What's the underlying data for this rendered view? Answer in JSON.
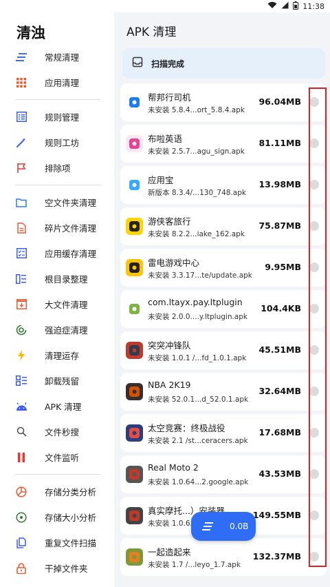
{
  "status_bar": {
    "time": "11:38"
  },
  "sidebar": {
    "title": "清浊",
    "groups": [
      [
        {
          "label": "常规清理",
          "icon": "sweep-icon"
        },
        {
          "label": "应用清理",
          "icon": "grid-icon"
        }
      ],
      [
        {
          "label": "规则管理",
          "icon": "list-icon"
        },
        {
          "label": "规则工坊",
          "icon": "magic-wand-icon"
        },
        {
          "label": "排除项",
          "icon": "flag-icon"
        }
      ],
      [
        {
          "label": "空文件夹清理",
          "icon": "folder-icon"
        },
        {
          "label": "碎片文件清理",
          "icon": "document-icon"
        },
        {
          "label": "应用缓存清理",
          "icon": "checklist-icon"
        },
        {
          "label": "根目录整理",
          "icon": "columns-icon"
        },
        {
          "label": "大文件清理",
          "icon": "archive-icon"
        },
        {
          "label": "强迫症清理",
          "icon": "target-icon"
        },
        {
          "label": "清理运存",
          "icon": "lightning-icon"
        },
        {
          "label": "卸载残留",
          "icon": "apps-list-icon"
        },
        {
          "label": "APK 清理",
          "icon": "android-icon"
        },
        {
          "label": "文件秒搜",
          "icon": "search-icon"
        },
        {
          "label": "文件监听",
          "icon": "pause-icon"
        }
      ],
      [
        {
          "label": "存储分类分析",
          "icon": "pie-chart-icon"
        },
        {
          "label": "存储大小分析",
          "icon": "disk-icon"
        },
        {
          "label": "重复文件扫描",
          "icon": "copy-icon"
        },
        {
          "label": "干掉文件夹",
          "icon": "lock-icon"
        }
      ]
    ]
  },
  "main": {
    "title": "APK 清理",
    "scan_status": "扫描完成",
    "items": [
      {
        "name": "帮邦行司机",
        "sub": "未安装 5.8.4...ort_5.8.4.apk",
        "size": "96.04MB",
        "icon_bg": "#ffffff",
        "icon_fg": "#1e7cf2"
      },
      {
        "name": "布啦英语",
        "sub": "未安装 2.5.7...agu_sign.apk",
        "size": "81.11MB",
        "icon_bg": "#fde9f2",
        "icon_fg": "#e84393"
      },
      {
        "name": "应用宝",
        "sub": "新版本 8.3.4/...130_748.apk",
        "size": "13.98MB",
        "icon_bg": "#ffffff",
        "icon_fg": "#33aaff"
      },
      {
        "name": "游侠客旅行",
        "sub": "未安装 8.2.2...iake_162.apk",
        "size": "75.87MB",
        "icon_bg": "#ffd400",
        "icon_fg": "#222222"
      },
      {
        "name": "雷电游戏中心",
        "sub": "未安装 3.3.17...te/update.apk",
        "size": "9.95MB",
        "icon_bg": "#ffc400",
        "icon_fg": "#222222"
      },
      {
        "name": "com.ltayx.pay.ltplugin",
        "sub": "未安装 2.0.0....y.ltplugin.apk",
        "size": "104.4KB",
        "icon_bg": "#ffffff",
        "icon_fg": "#7cb342"
      },
      {
        "name": "突突冲锋队",
        "sub": "未安装 1.0.1 /...fd_1.0.1.apk",
        "size": "45.51MB",
        "icon_bg": "#c0392b",
        "icon_fg": "#2c3e50"
      },
      {
        "name": "NBA 2K19",
        "sub": "未安装 52.0.1...d_52.0.1.apk",
        "size": "32.64MB",
        "icon_bg": "#3b2d2d",
        "icon_fg": "#d35400"
      },
      {
        "name": "太空竞赛：终极战役",
        "sub": "未安装 2.1 /st...ceracers.apk",
        "size": "17.68MB",
        "icon_bg": "#2c3e80",
        "icon_fg": "#e74c3c"
      },
      {
        "name": "Real Moto 2",
        "sub": "未安装 1.0.64...2.google.apk",
        "size": "43.53MB",
        "icon_bg": "#555555",
        "icon_fg": "#c0392b"
      },
      {
        "name": "真实摩托...）安装器",
        "sub": "未安装 1.0.6...",
        "size": "149.55MB",
        "icon_bg": "#444444",
        "icon_fg": "#c0392b"
      },
      {
        "name": "一起造起来",
        "sub": "未安装 1.7 /...leyo_1.7.apk",
        "size": "132.37MB",
        "icon_bg": "#7d9a3a",
        "icon_fg": "#e67e22"
      }
    ]
  },
  "fab": {
    "label": "0.0B"
  }
}
